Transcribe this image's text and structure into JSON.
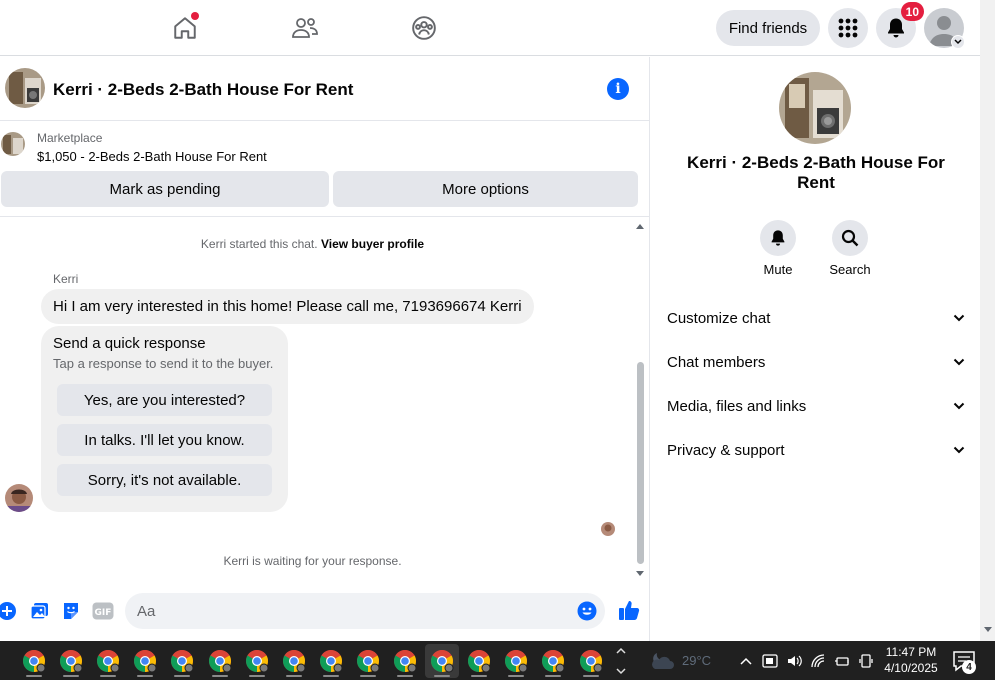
{
  "nav": {
    "find_friends": "Find friends",
    "notifications_count": "10",
    "icons": [
      "home-icon",
      "friends-icon",
      "groups-icon",
      "menu-grid-icon",
      "bell-icon",
      "profile-avatar"
    ]
  },
  "chat": {
    "title": "Kerri · 2-Beds 2-Bath House For Rent",
    "marketplace_label": "Marketplace",
    "listing": "$1,050 - 2-Beds 2-Bath House For Rent",
    "mark_pending": "Mark as pending",
    "more_options": "More options",
    "started_prefix": "Kerri started this chat.",
    "view_profile": "View buyer profile",
    "sender": "Kerri",
    "message": "Hi I am very interested in this home! Please call me, 7193696674 Kerri",
    "quick_title": "Send a quick response",
    "quick_sub": "Tap a response to send it to the buyer.",
    "quick_responses": [
      "Yes, are you interested?",
      "In talks. I'll let you know.",
      "Sorry, it's not available."
    ],
    "waiting": "Kerri is waiting for your response.",
    "composer_placeholder": "Aa",
    "gif_label": "GIF"
  },
  "side": {
    "title": "Kerri · 2-Beds 2-Bath House For Rent",
    "mute": "Mute",
    "search": "Search",
    "sections": [
      "Customize chat",
      "Chat members",
      "Media, files and links",
      "Privacy & support"
    ]
  },
  "taskbar": {
    "weather": "29°C",
    "time": "11:47 PM",
    "date": "4/10/2025",
    "notification_count": "4",
    "app_count": 16
  },
  "colors": {
    "accent": "#0866ff",
    "badge": "#e41e3f",
    "bubble": "#f0f0f0",
    "button": "#e4e6eb"
  }
}
